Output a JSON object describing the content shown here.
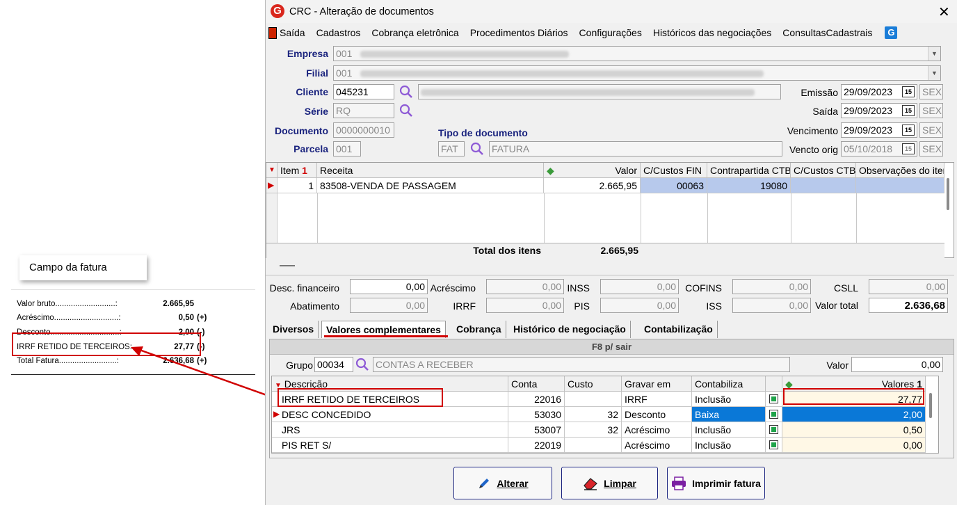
{
  "annotation": {
    "callout_title": "Campo da fatura",
    "invoice_rows": [
      {
        "label": "Valor bruto...........................:",
        "value": "2.665,95",
        "sign": ""
      },
      {
        "label": "Acréscimo.............................:",
        "value": "0,50",
        "sign": "(+)"
      },
      {
        "label": "Desconto...............................:",
        "value": "2,00",
        "sign": "(-)"
      },
      {
        "label": "IRRF RETIDO DE TERCEIROS:",
        "value": "27,77",
        "sign": "(-)"
      },
      {
        "label": "Total Fatura..........................:",
        "value": "2.636,68",
        "sign": "(+)"
      }
    ]
  },
  "window": {
    "title": "CRC - Alteração de documentos",
    "close": "✕",
    "menu": [
      "Saída",
      "Cadastros",
      "Cobrança eletrônica",
      "Procedimentos Diários",
      "Configurações",
      "Históricos das negociações",
      "ConsultasCadastrais"
    ]
  },
  "header": {
    "empresa_label": "Empresa",
    "empresa_value": "001",
    "filial_label": "Filial",
    "filial_value": "001",
    "cliente_label": "Cliente",
    "cliente_value": "045231",
    "serie_label": "Série",
    "serie_value": "RQ",
    "documento_label": "Documento",
    "documento_value": "0000000010",
    "parcela_label": "Parcela",
    "parcela_value": "001",
    "tipo_label": "Tipo de documento",
    "tipo_code": "FAT",
    "tipo_desc": "FATURA",
    "emissao_label": "Emissão",
    "emissao_value": "29/09/2023",
    "emissao_day": "SEX",
    "saida_label": "Saída",
    "saida_value": "29/09/2023",
    "saida_day": "SEX",
    "vencimento_label": "Vencimento",
    "vencimento_value": "29/09/2023",
    "vencimento_day": "SEX",
    "vencto_orig_label": "Vencto orig",
    "vencto_orig_value": "05/10/2018",
    "vencto_orig_day": "SEX",
    "cal_glyph": "15"
  },
  "items_grid": {
    "headers": {
      "item": "Item",
      "sort": "1",
      "receita": "Receita",
      "valor": "Valor",
      "ccfin": "C/Custos FIN",
      "contrapartida": "Contrapartida CTB",
      "ccctb": "C/Custos CTB",
      "obs": "Observações do item"
    },
    "row": {
      "item": "1",
      "receita": "83508-VENDA DE PASSAGEM",
      "valor": "2.665,95",
      "ccfin": "00063",
      "contrapartida": "19080"
    },
    "total_label": "Total dos itens",
    "total_value": "2.665,95"
  },
  "totals": {
    "desc_fin_label": "Desc. financeiro",
    "desc_fin": "0,00",
    "acrescimo_label": "Acréscimo",
    "acrescimo": "0,00",
    "inss_label": "INSS",
    "inss": "0,00",
    "cofins_label": "COFINS",
    "cofins": "0,00",
    "csll_label": "CSLL",
    "csll": "0,00",
    "abatimento_label": "Abatimento",
    "abatimento": "0,00",
    "irrf_label": "IRRF",
    "irrf": "0,00",
    "pis_label": "PIS",
    "pis": "0,00",
    "iss_label": "ISS",
    "iss": "0,00",
    "valor_total_label": "Valor total",
    "valor_total": "2.636,68"
  },
  "tabs": [
    "Diversos",
    "Valores complementares",
    "Cobrança",
    "Histórico de negociação",
    "Contabilização"
  ],
  "complementares": {
    "exit_hint": "F8 p/ sair",
    "grupo_label": "Grupo",
    "grupo_code": "00034",
    "grupo_desc": "CONTAS A RECEBER",
    "valor_label": "Valor",
    "valor": "0,00",
    "headers": {
      "descricao": "Descrição",
      "conta": "Conta",
      "custo": "Custo",
      "gravar": "Gravar em",
      "contabiliza": "Contabiliza",
      "valores": "Valores",
      "sort": "1"
    },
    "rows": [
      {
        "descricao": "IRRF RETIDO DE TERCEIROS",
        "conta": "22016",
        "custo": "",
        "gravar": "IRRF",
        "contabiliza": "Inclusão",
        "valor": "27,77"
      },
      {
        "descricao": "DESC CONCEDIDO",
        "conta": "53030",
        "custo": "32",
        "gravar": "Desconto",
        "contabiliza": "Baixa",
        "valor": "2,00"
      },
      {
        "descricao": "JRS",
        "conta": "53007",
        "custo": "32",
        "gravar": "Acréscimo",
        "contabiliza": "Inclusão",
        "valor": "0,50"
      },
      {
        "descricao": "PIS RET S/",
        "conta": "22019",
        "custo": "",
        "gravar": "Acréscimo",
        "contabiliza": "Inclusão",
        "valor": "0,00"
      }
    ]
  },
  "buttons": {
    "alterar": "Alterar",
    "limpar": "Limpar",
    "imprimir": "Imprimir fatura"
  },
  "colors": {
    "accent": "#1a237e",
    "highlight_red": "#d00000",
    "selected_row": "#0a78d7"
  }
}
